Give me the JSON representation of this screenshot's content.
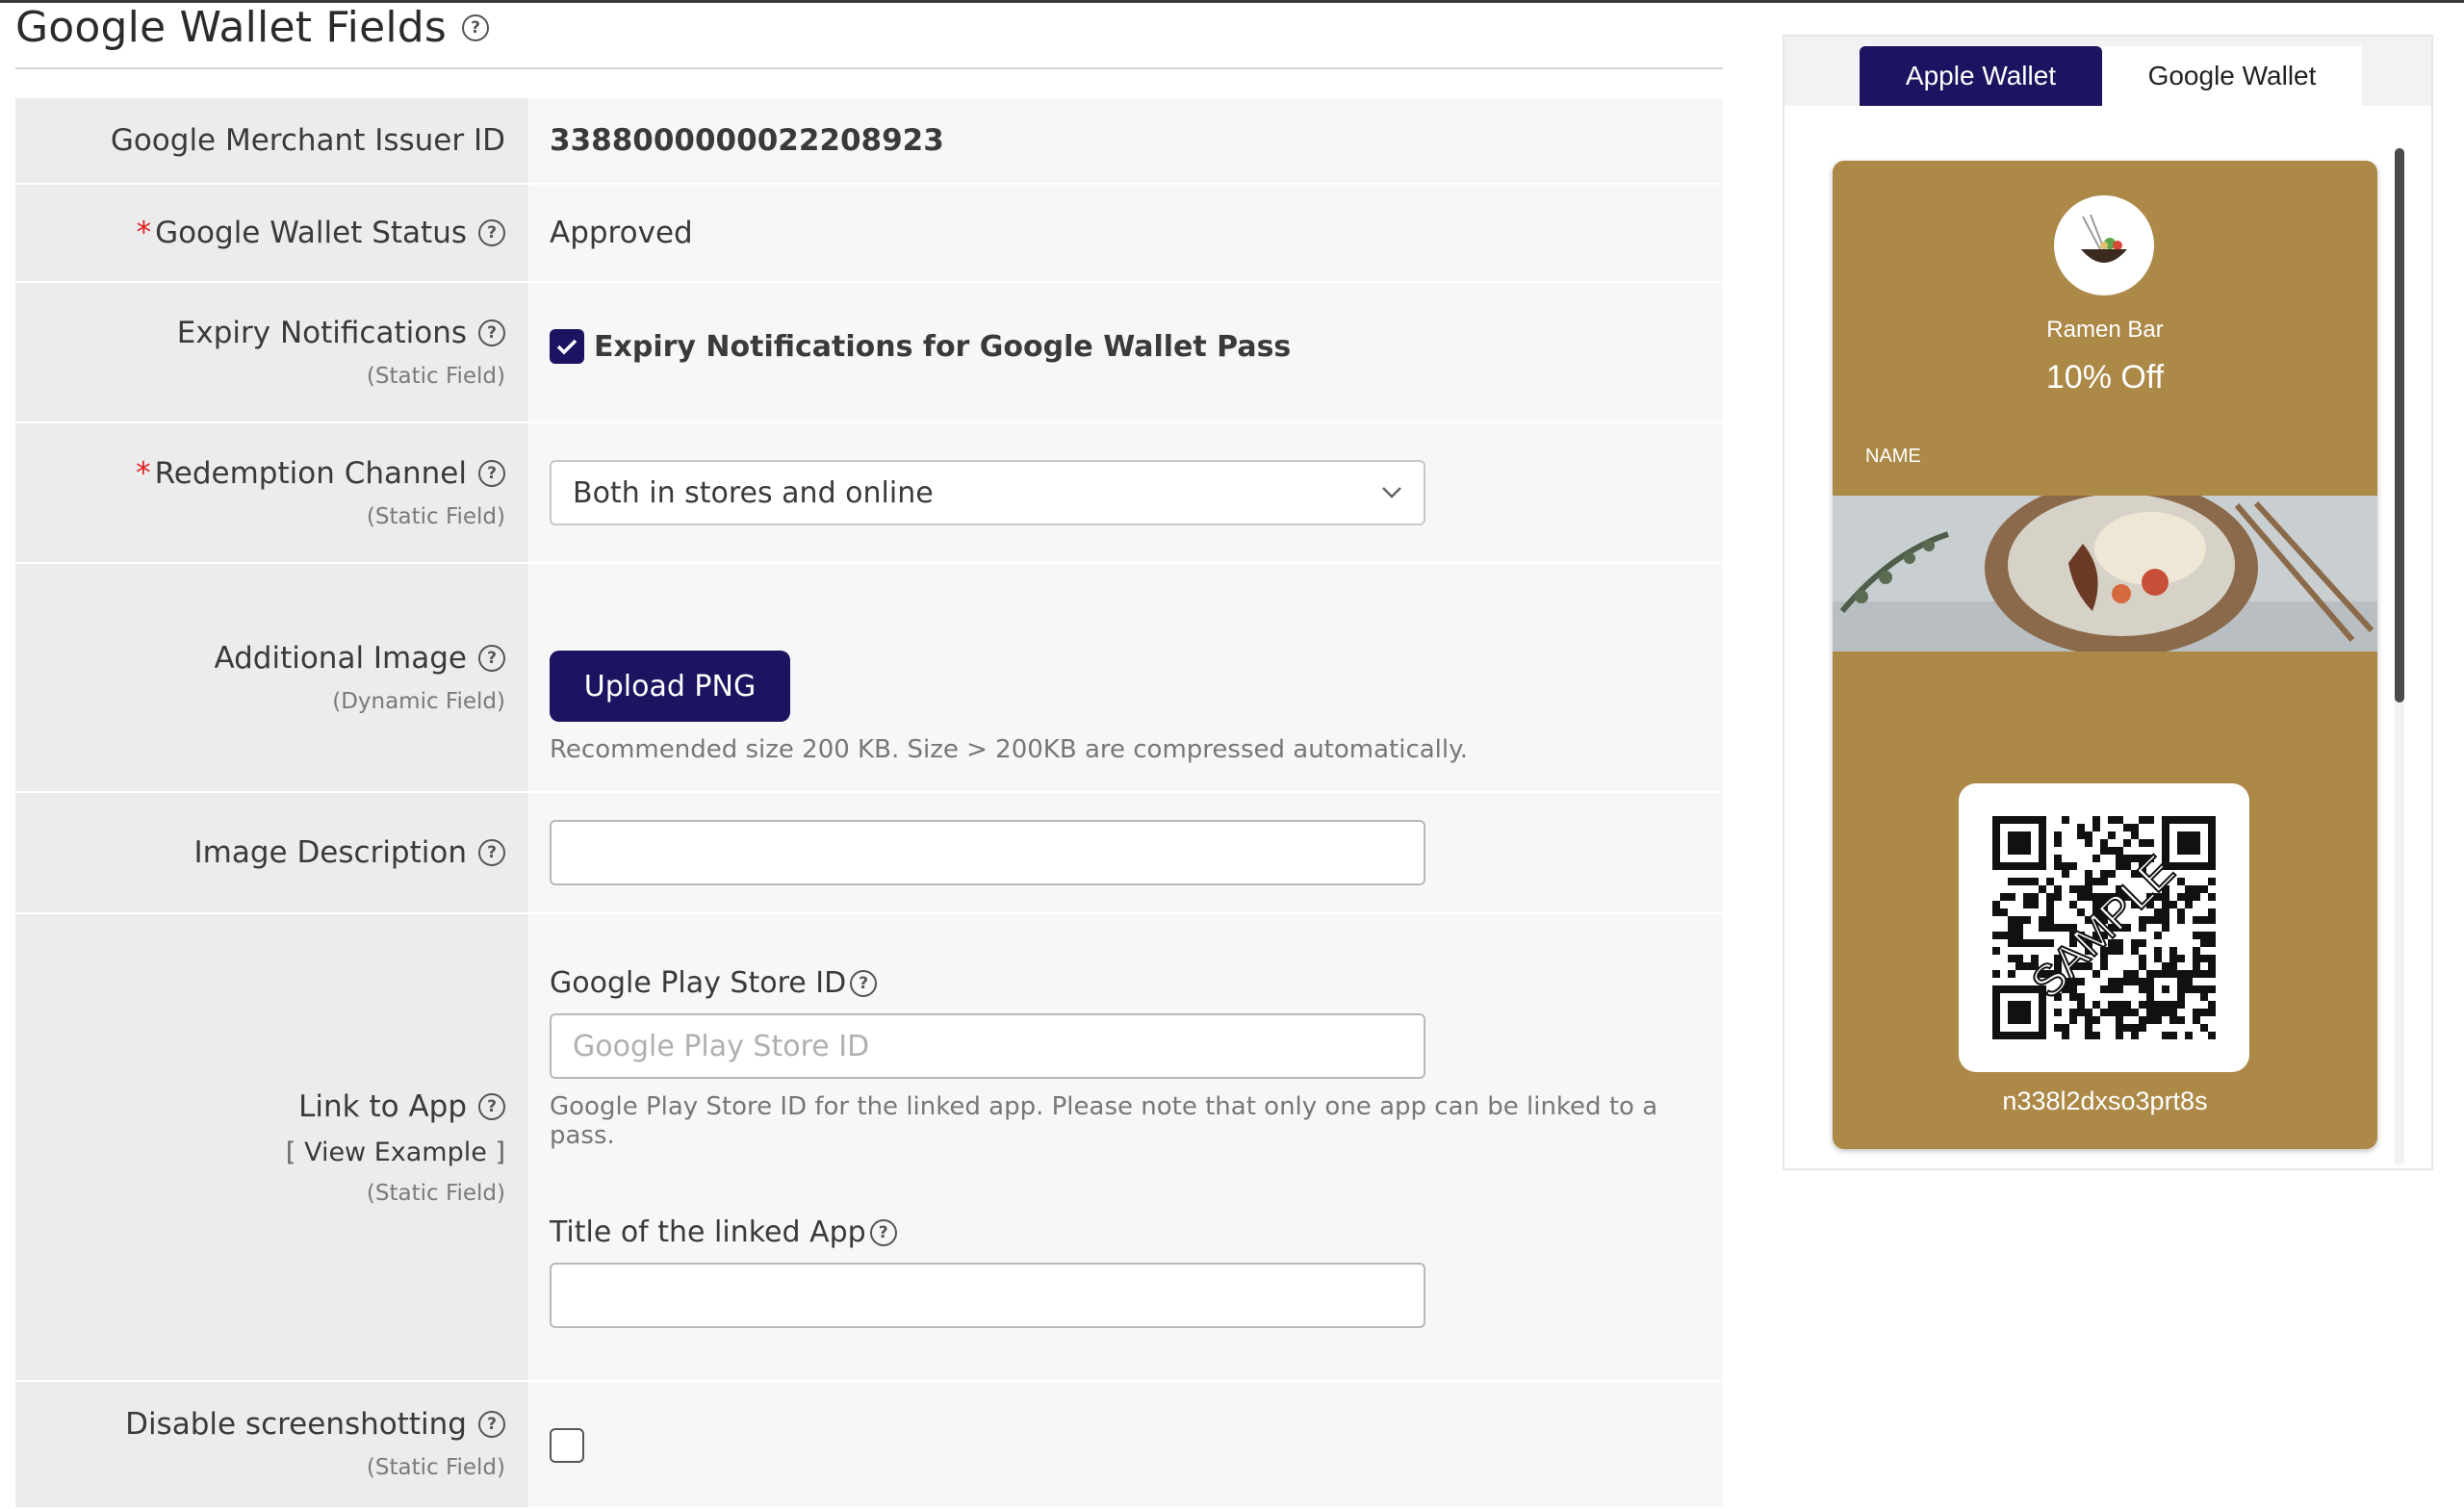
{
  "header": {
    "title": "Google Wallet Fields"
  },
  "form": {
    "merchant_issuer_id": {
      "label": "Google Merchant Issuer ID",
      "value": "3388000000022208923"
    },
    "wallet_status": {
      "required_mark": "*",
      "label": "Google Wallet Status",
      "value": "Approved"
    },
    "expiry_notifications": {
      "label": "Expiry Notifications",
      "sub": "(Static Field)",
      "checkbox_label": "Expiry Notifications for Google Wallet Pass",
      "checked": true
    },
    "redemption_channel": {
      "required_mark": "*",
      "label": "Redemption Channel",
      "sub": "(Static Field)",
      "selected": "Both in stores and online"
    },
    "additional_image": {
      "label": "Additional Image",
      "sub": "(Dynamic Field)",
      "button": "Upload PNG",
      "hint": "Recommended size 200 KB. Size > 200KB are compressed automatically."
    },
    "image_description": {
      "label": "Image Description",
      "value": ""
    },
    "link_to_app": {
      "label": "Link to App",
      "view_example_open": "[",
      "view_example": "View Example",
      "view_example_close": "]",
      "sub": "(Static Field)",
      "play_store_label": "Google Play Store ID",
      "play_store_placeholder": "Google Play Store ID",
      "play_store_hint": "Google Play Store ID for the linked app. Please note that only one app can be linked to a pass.",
      "app_title_label": "Title of the linked App",
      "app_title_value": ""
    },
    "disable_screenshotting": {
      "label": "Disable screenshotting",
      "sub": "(Static Field)",
      "checked": false
    }
  },
  "preview": {
    "tabs": [
      {
        "label": "Apple Wallet",
        "active": true
      },
      {
        "label": "Google Wallet",
        "active": false
      }
    ],
    "card": {
      "merchant": "Ramen Bar",
      "offer": "10% Off",
      "name_label": "NAME",
      "barcode_text": "n338l2dxso3prt8s",
      "qr_watermark": "SAMPLE",
      "background_color": "#ad8948"
    },
    "accent_color": "#1c1460"
  }
}
